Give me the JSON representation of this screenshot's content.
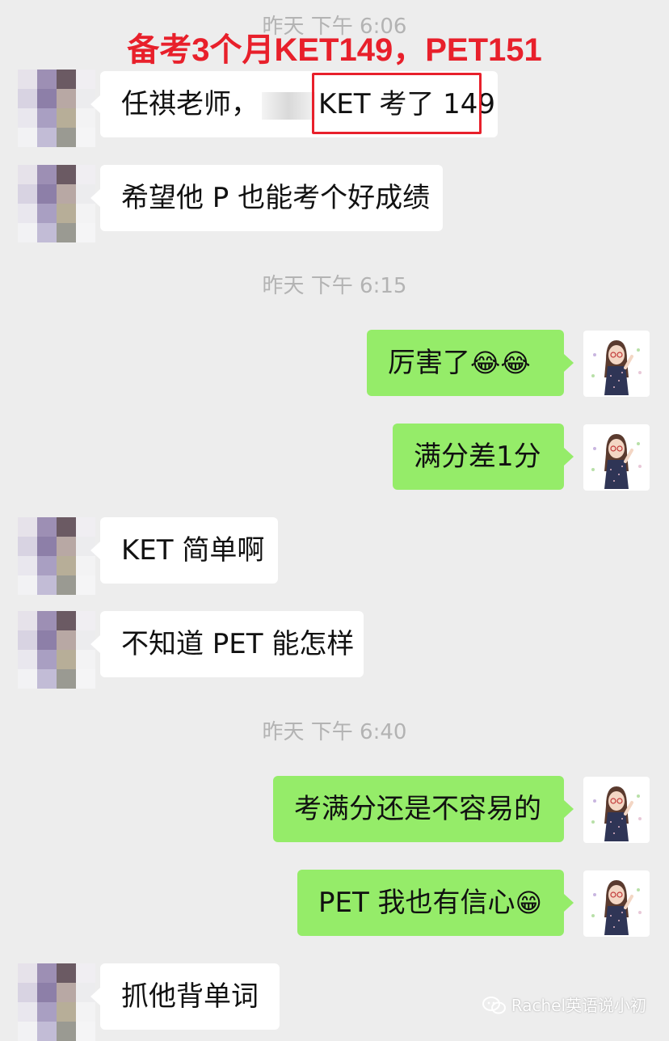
{
  "headline": "备考3个月KET149，PET151",
  "timestamps": [
    "昨天  下午 6:06",
    "昨天  下午 6:15",
    "昨天  下午 6:40"
  ],
  "messages": [
    {
      "side": "in",
      "text_pre": "任祺老师，",
      "text_post": "KET 考了 149"
    },
    {
      "side": "in",
      "text": "希望他 P 也能考个好成绩"
    },
    {
      "side": "out",
      "text": "厉害了",
      "emoji": "😂😂"
    },
    {
      "side": "out",
      "text": "满分差1分"
    },
    {
      "side": "in",
      "text": "KET 简单啊"
    },
    {
      "side": "in",
      "text": "不知道 PET 能怎样"
    },
    {
      "side": "out",
      "text": "考满分还是不容易的"
    },
    {
      "side": "out",
      "text": "PET 我也有信心",
      "emoji": "😁"
    },
    {
      "side": "in",
      "text": "抓他背单词"
    }
  ],
  "watermark": "Rachel英语说小初",
  "colors": {
    "background": "#ededed",
    "outgoing_bubble": "#95ec69",
    "incoming_bubble": "#ffffff",
    "highlight": "#e8202b"
  }
}
